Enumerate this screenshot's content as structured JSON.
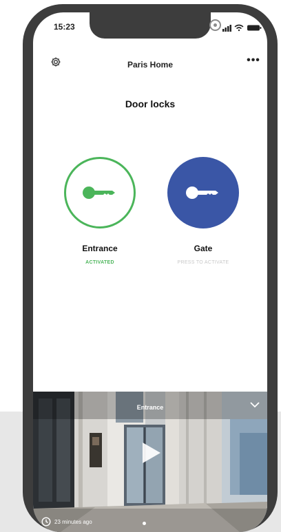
{
  "status_bar": {
    "time": "15:23",
    "icons": [
      "signal-icon",
      "wifi-icon",
      "battery-icon"
    ]
  },
  "header": {
    "title": "Paris Home",
    "left_icon": "gear-icon",
    "right_icon": "more-icon",
    "more_glyph": "•••"
  },
  "section": {
    "title": "Door locks"
  },
  "locks": [
    {
      "name": "Entrance",
      "status": "ACTIVATED",
      "icon": "key-icon",
      "state": "activated",
      "color": "#4bb55a"
    },
    {
      "name": "Gate",
      "status": "PRESS TO ACTIVATE",
      "icon": "key-icon",
      "state": "inactive",
      "color": "#3a56a6"
    }
  ],
  "video": {
    "title": "Entrance",
    "collapse_icon": "chevron-down-icon",
    "play_icon": "play-icon",
    "timestamp": "23 minutes ago",
    "timestamp_icon": "clock-icon"
  },
  "colors": {
    "accent_green": "#4bb55a",
    "accent_blue": "#3a56a6",
    "device_frame": "#3d3d3d"
  }
}
